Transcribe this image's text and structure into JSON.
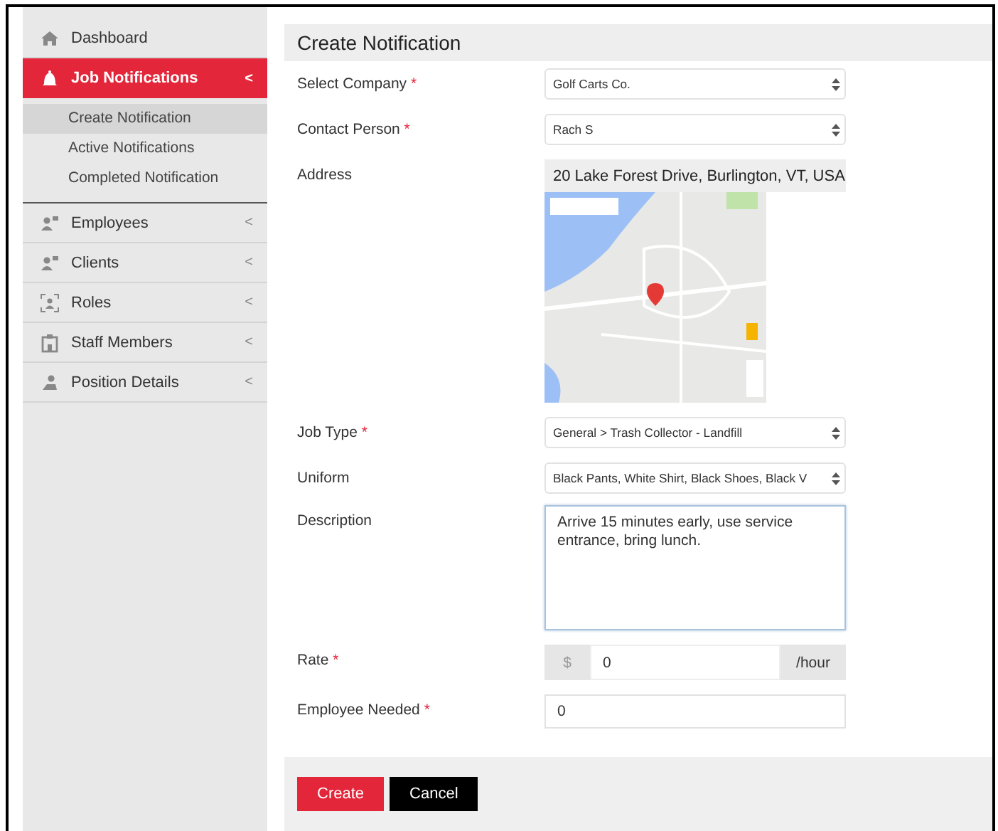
{
  "sidebar": {
    "items": [
      {
        "label": "Dashboard",
        "selected": false
      },
      {
        "label": "Job Notifications",
        "selected": true,
        "caret": "<",
        "children": [
          {
            "label": "Create Notification",
            "selected": true
          },
          {
            "label": "Active Notifications",
            "selected": false
          },
          {
            "label": "Completed Notification",
            "selected": false
          }
        ]
      },
      {
        "label": "Employees",
        "selected": false,
        "caret": "<"
      },
      {
        "label": "Clients",
        "selected": false,
        "caret": "<"
      },
      {
        "label": "Roles",
        "selected": false,
        "caret": "<"
      },
      {
        "label": "Staff Members",
        "selected": false,
        "caret": "<"
      },
      {
        "label": "Position Details",
        "selected": false,
        "caret": "<"
      }
    ]
  },
  "panel": {
    "title": "Create Notification"
  },
  "form": {
    "fields": [
      {
        "kind": "select",
        "label": "Select Company",
        "required": true,
        "value": "Golf Carts Co."
      },
      {
        "kind": "select",
        "label": "Contact Person",
        "required": true,
        "value": "Rach S"
      },
      {
        "kind": "address",
        "label": "Address",
        "required": false,
        "value": "20 Lake Forest Drive, Burlington, VT, USA"
      },
      {
        "kind": "select",
        "label": "Job Type",
        "required": true,
        "value": "General > Trash Collector - Landfill"
      },
      {
        "kind": "select",
        "label": "Uniform",
        "required": false,
        "value": "Black Pants, White Shirt, Black Shoes, Black V"
      },
      {
        "kind": "textarea",
        "label": "Description",
        "required": false,
        "value": "Arrive 15 minutes early, use service entrance, bring lunch."
      },
      {
        "kind": "money",
        "label": "Rate",
        "required": true,
        "prefix": "$",
        "value": "0",
        "suffix": "/hour"
      },
      {
        "kind": "input",
        "label": "Employee Needed",
        "required": true,
        "value": "0"
      }
    ],
    "required_mark": "*"
  },
  "buttons": [
    {
      "label": "Create",
      "kind": "primary"
    },
    {
      "label": "Cancel",
      "kind": "secondary"
    }
  ]
}
